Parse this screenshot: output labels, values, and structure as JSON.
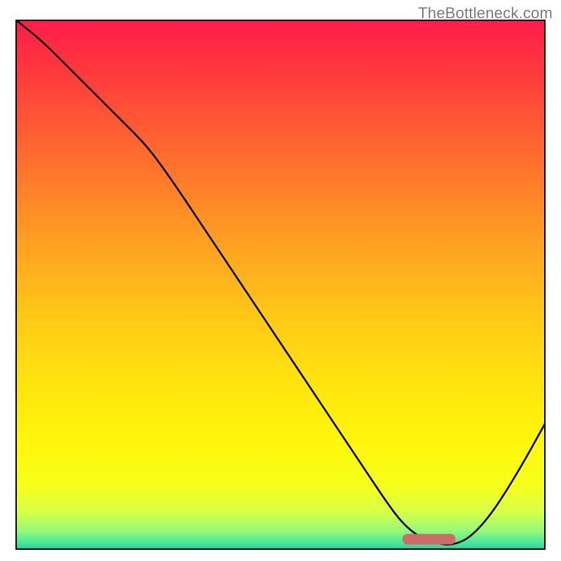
{
  "watermark": "TheBottleneck.com",
  "chart_data": {
    "type": "line",
    "title": "",
    "xlabel": "",
    "ylabel": "",
    "xlim": [
      0,
      100
    ],
    "ylim": [
      0,
      100
    ],
    "series": [
      {
        "name": "curve",
        "color": "#000000",
        "x": [
          0,
          5,
          10,
          15,
          20,
          25,
          30,
          35,
          40,
          45,
          50,
          55,
          60,
          65,
          70,
          73,
          76,
          80,
          83,
          86,
          90,
          95,
          100
        ],
        "y": [
          100,
          96,
          91,
          86,
          81,
          76,
          69,
          61.5,
          54,
          46.5,
          39,
          31.5,
          24,
          16.5,
          9,
          5,
          2.5,
          1,
          1,
          2.5,
          7,
          15,
          24
        ]
      }
    ],
    "marker": {
      "name": "optimal-range",
      "color": "#cf6b66",
      "x_range": [
        73,
        83
      ],
      "y": 1,
      "height": 2
    },
    "gradient_stops": [
      {
        "offset": 0.0,
        "color": "#ff1c4b"
      },
      {
        "offset": 0.1,
        "color": "#ff3a3c"
      },
      {
        "offset": 0.25,
        "color": "#ff6a2f"
      },
      {
        "offset": 0.4,
        "color": "#ff9a23"
      },
      {
        "offset": 0.55,
        "color": "#ffc617"
      },
      {
        "offset": 0.68,
        "color": "#ffe30e"
      },
      {
        "offset": 0.8,
        "color": "#fff70a"
      },
      {
        "offset": 0.88,
        "color": "#f6ff1a"
      },
      {
        "offset": 0.93,
        "color": "#d7ff4a"
      },
      {
        "offset": 0.965,
        "color": "#93f97a"
      },
      {
        "offset": 0.985,
        "color": "#4fe999"
      },
      {
        "offset": 0.997,
        "color": "#27d8a2"
      },
      {
        "offset": 1.0,
        "color": "#1fd2a3"
      }
    ]
  }
}
